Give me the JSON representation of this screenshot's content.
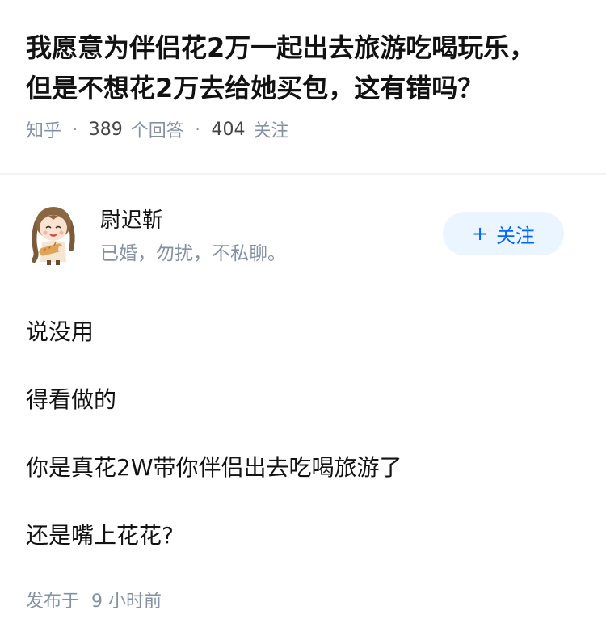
{
  "question": {
    "title": "我愿意为伴侣花2万一起出去旅游吃喝玩乐，但是不想花2万去给她买包，这有错吗？",
    "source": "知乎",
    "separator": "·",
    "answer_count": "389",
    "answer_label": "个回答",
    "follow_count": "404",
    "follow_label": "关注"
  },
  "author": {
    "name": "尉迟靳",
    "bio": "已婚，勿扰，不私聊。",
    "avatar_icon": "cartoon-girl-avatar",
    "follow_button": {
      "icon": "plus-icon",
      "plus": "+",
      "label": "关注"
    }
  },
  "answer": {
    "paragraphs": [
      "说没用",
      "得看做的",
      "你是真花2W带你伴侣出去吃喝旅游了",
      "还是嘴上花花?"
    ],
    "published_prefix": "发布于",
    "published_time": "9 小时前"
  },
  "colors": {
    "accent": "#0066ff",
    "button_bg": "#ebf5ff",
    "meta_gray": "#8590a6",
    "text": "#121212"
  }
}
